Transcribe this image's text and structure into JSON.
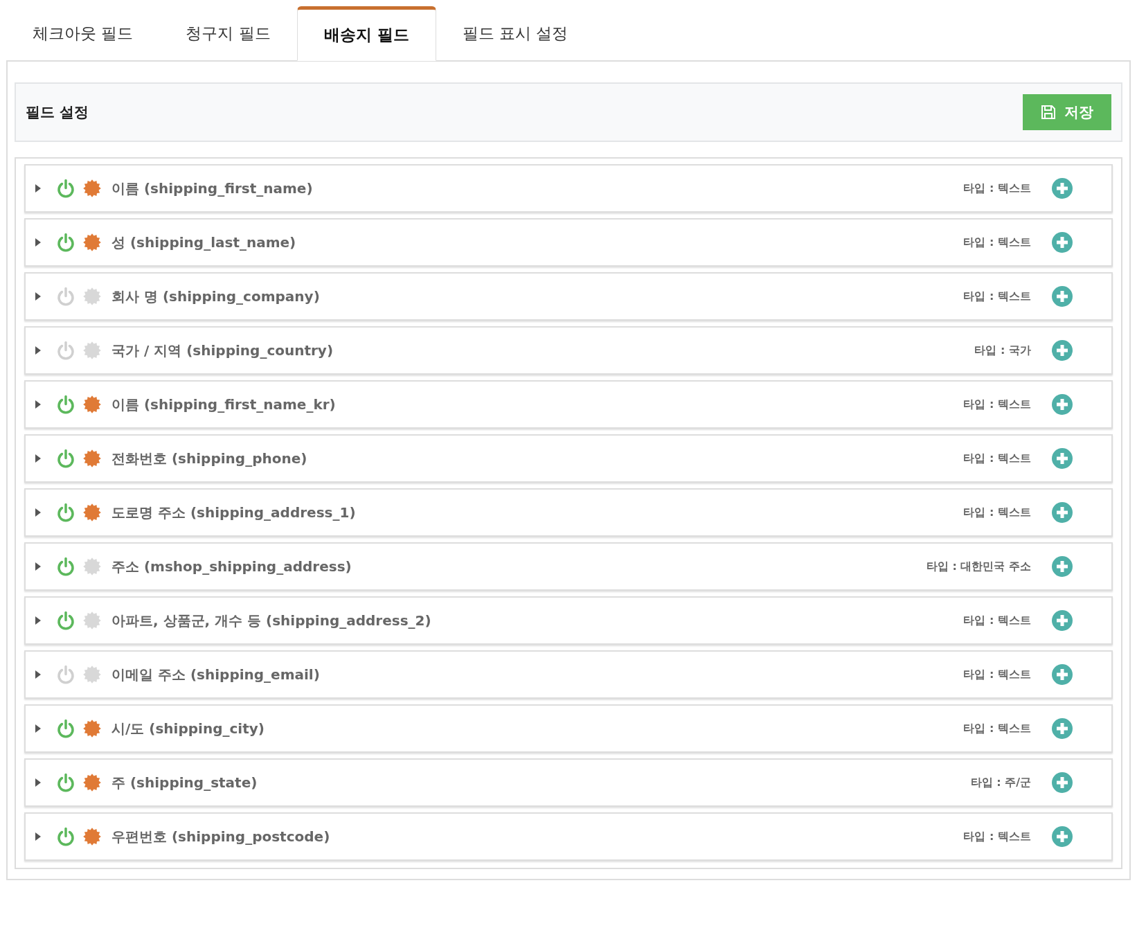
{
  "tabs": [
    {
      "label": "체크아웃 필드",
      "selected": false
    },
    {
      "label": "청구지 필드",
      "selected": false
    },
    {
      "label": "배송지 필드",
      "selected": true
    },
    {
      "label": "필드 표시 설정",
      "selected": false
    }
  ],
  "panel": {
    "title": "필드 설정",
    "save_button": "저장"
  },
  "fields": [
    {
      "label": "이름 (shipping_first_name)",
      "type": "타입 : 텍스트",
      "enabled": true,
      "required": true
    },
    {
      "label": "성 (shipping_last_name)",
      "type": "타입 : 텍스트",
      "enabled": true,
      "required": true
    },
    {
      "label": "회사 명 (shipping_company)",
      "type": "타입 : 텍스트",
      "enabled": false,
      "required": false
    },
    {
      "label": "국가 / 지역 (shipping_country)",
      "type": "타입 : 국가",
      "enabled": false,
      "required": false
    },
    {
      "label": "이름 (shipping_first_name_kr)",
      "type": "타입 : 텍스트",
      "enabled": true,
      "required": true
    },
    {
      "label": "전화번호 (shipping_phone)",
      "type": "타입 : 텍스트",
      "enabled": true,
      "required": true
    },
    {
      "label": "도로명 주소 (shipping_address_1)",
      "type": "타입 : 텍스트",
      "enabled": true,
      "required": true
    },
    {
      "label": "주소 (mshop_shipping_address)",
      "type": "타입 : 대한민국 주소",
      "enabled": true,
      "required": false
    },
    {
      "label": "아파트, 상품군, 개수 등 (shipping_address_2)",
      "type": "타입 : 텍스트",
      "enabled": true,
      "required": false
    },
    {
      "label": "이메일 주소 (shipping_email)",
      "type": "타입 : 텍스트",
      "enabled": false,
      "required": false
    },
    {
      "label": "시/도 (shipping_city)",
      "type": "타입 : 텍스트",
      "enabled": true,
      "required": true
    },
    {
      "label": "주 (shipping_state)",
      "type": "타입 : 주/군",
      "enabled": true,
      "required": true
    },
    {
      "label": "우편번호 (shipping_postcode)",
      "type": "타입 : 텍스트",
      "enabled": true,
      "required": true
    }
  ]
}
